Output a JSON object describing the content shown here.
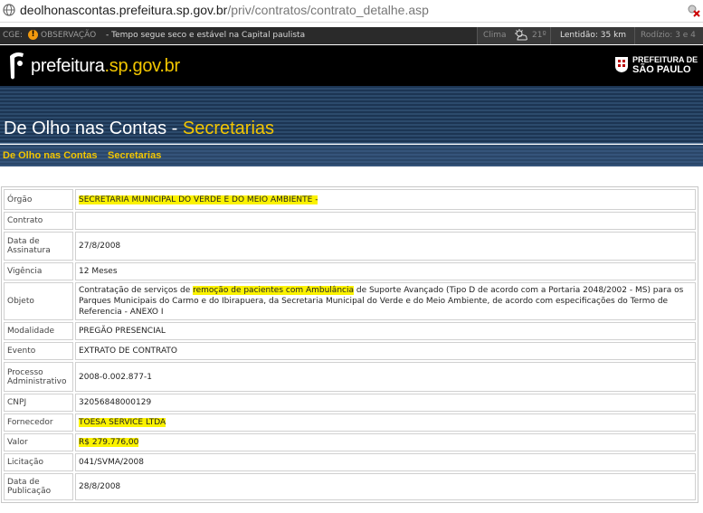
{
  "browser": {
    "url_host": "deolhonascontas.prefeitura.sp.gov.br",
    "url_path": "/priv/contratos/contrato_detalhe.asp"
  },
  "ticker": {
    "cge": "CGE:",
    "observacao": "OBSERVAÇÃO",
    "message": "- Tempo segue seco e estável na Capital paulista",
    "clima_label": "Clima",
    "clima_temp": "21º",
    "lentidao": "Lentidão: 35 km",
    "rodizio": "Rodízio: 3 e 4"
  },
  "header": {
    "logo_main": "prefeitura",
    "logo_accent": ".sp.gov.br",
    "pref_line1": "PREFEITURA DE",
    "pref_line2": "SÃO PAULO"
  },
  "banner": {
    "title_main": "De Olho nas Contas - ",
    "title_accent": "Secretarias"
  },
  "breadcrumb": {
    "item1": "De Olho nas Contas",
    "item2": "Secretarias"
  },
  "contract": {
    "orgao_label": "Órgão",
    "orgao_value": "SECRETARIA MUNICIPAL DO VERDE E DO MEIO AMBIENTE -",
    "contrato_label": "Contrato",
    "contrato_value": "",
    "data_assinatura_label": "Data de Assinatura",
    "data_assinatura_value": "27/8/2008",
    "vigencia_label": "Vigência",
    "vigencia_value": "12 Meses",
    "objeto_label": "Objeto",
    "objeto_pre": "Contratação de serviços de ",
    "objeto_highlight": "remoção de pacientes com Ambulância",
    "objeto_post": " de Suporte Avançado (Tipo D de acordo com a Portaria 2048/2002 - MS) para os Parques Municipais do Carmo e do Ibirapuera, da Secretaria Municipal do Verde e do Meio Ambiente, de acordo com especificações do Termo de Referencia - ANEXO I",
    "modalidade_label": "Modalidade",
    "modalidade_value": "PREGÃO PRESENCIAL",
    "evento_label": "Evento",
    "evento_value": "EXTRATO DE CONTRATO",
    "processo_label": "Processo Administrativo",
    "processo_value": "2008-0.002.877-1",
    "cnpj_label": "CNPJ",
    "cnpj_value": "32056848000129",
    "fornecedor_label": "Fornecedor",
    "fornecedor_value": "TOESA SERVICE LTDA",
    "valor_label": "Valor",
    "valor_value": "R$ 279.776,00",
    "licitacao_label": "Licitação",
    "licitacao_value": "041/SVMA/2008",
    "data_publicacao_label": "Data de Publicação",
    "data_publicacao_value": "28/8/2008"
  }
}
